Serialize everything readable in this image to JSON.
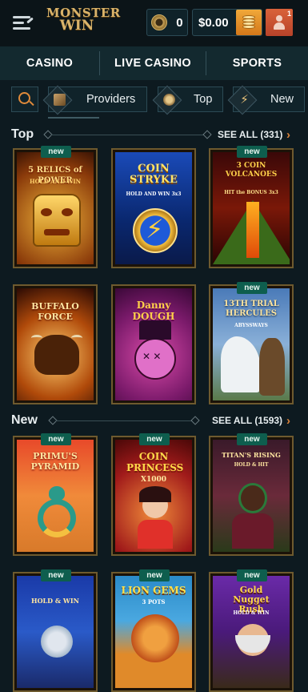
{
  "header": {
    "logo_line1": "MONSTER",
    "logo_line2": "WIN",
    "coins": "0",
    "balance": "$0.00",
    "notifications": "1"
  },
  "nav": {
    "tabs": [
      "CASINO",
      "LIVE CASINO",
      "SPORTS"
    ]
  },
  "filters": {
    "chips": [
      "Providers",
      "Top",
      "New"
    ]
  },
  "sections": {
    "top": {
      "title": "Top",
      "see_all": "SEE ALL (331)",
      "games": [
        {
          "badge": "new",
          "title": "5 RELICS of POWER",
          "subtitle": "HOLD AND WIN"
        },
        {
          "badge": "",
          "title": "COIN STRYKE",
          "subtitle": "HOLD AND WIN 3x3"
        },
        {
          "badge": "new",
          "title": "3 COIN VOLCANOES",
          "subtitle": "HIT the BONUS 3x3"
        },
        {
          "badge": "",
          "title": "BUFFALO FORCE",
          "subtitle": ""
        },
        {
          "badge": "",
          "title": "Danny DOUGH",
          "subtitle": ""
        },
        {
          "badge": "new",
          "title": "13TH TRIAL HERCULES",
          "subtitle": "ABYSSWAYS"
        }
      ]
    },
    "new": {
      "title": "New",
      "see_all": "SEE ALL (1593)",
      "games": [
        {
          "badge": "new",
          "title": "PRIMU'S PYRAMID",
          "subtitle": ""
        },
        {
          "badge": "new",
          "title": "COIN PRINCESS",
          "subtitle": "X1000"
        },
        {
          "badge": "new",
          "title": "TITAN'S RISING",
          "subtitle": "HOLD & HIT"
        },
        {
          "badge": "new",
          "title": "HOLD & WIN",
          "subtitle": ""
        },
        {
          "badge": "new",
          "title": "LION GEMS",
          "subtitle": "3 POTS"
        },
        {
          "badge": "new",
          "title": "Gold Nugget Rush",
          "subtitle": "HOLD & WIN"
        }
      ]
    }
  },
  "colors": {
    "accent": "#e08a3a",
    "badge": "#0e5e4e",
    "frame": "#6e5a2e"
  }
}
